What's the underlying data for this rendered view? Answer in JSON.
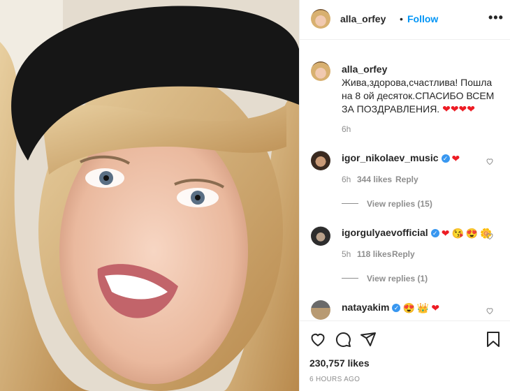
{
  "post": {
    "username": "alla_orfey",
    "follow_separator": "•",
    "follow_label": "Follow",
    "more_label": "•••"
  },
  "caption": {
    "username": "alla_orfey",
    "text": "Жива,здорова,счастлива! Пошла на 8 ой десяток.СПАСИБО ВСЕМ ЗА ПОЗДРАВЛЕНИЯ.",
    "time": "6h"
  },
  "comments": [
    {
      "username": "igor_nikolaev_music",
      "verified": true,
      "time": "6h",
      "likes": "344 likes",
      "reply_label": "Reply",
      "view_replies": "View replies (15)"
    },
    {
      "username": "igorgulyaevofficial",
      "verified": true,
      "time": "5h",
      "likes": "118 likes",
      "reply_label": "Reply",
      "view_replies": "View replies (1)"
    },
    {
      "username": "natayakim",
      "verified": true
    }
  ],
  "footer": {
    "likes": "230,757 likes",
    "ago": "6 HOURS AGO"
  },
  "colors": {
    "accent": "#0095f6",
    "verified": "#3897f0",
    "heart": "#ed1c24"
  }
}
